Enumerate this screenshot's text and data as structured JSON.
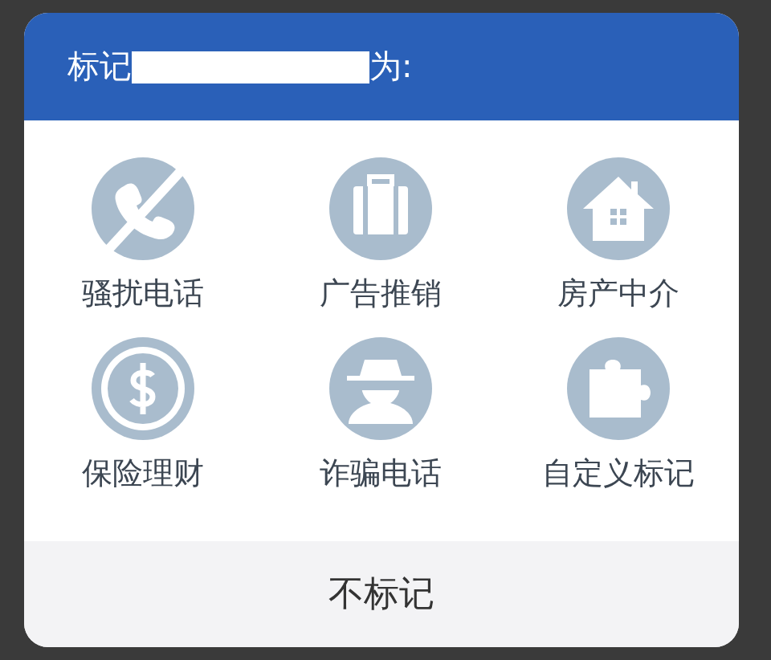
{
  "dialog": {
    "title_prefix": "标记",
    "title_suffix": "为:",
    "options": [
      {
        "kind": "blocked-phone",
        "label": "骚扰电话"
      },
      {
        "kind": "briefcase",
        "label": "广告推销"
      },
      {
        "kind": "house",
        "label": "房产中介"
      },
      {
        "kind": "coin",
        "label": "保险理财"
      },
      {
        "kind": "spy",
        "label": "诈骗电话"
      },
      {
        "kind": "puzzle",
        "label": "自定义标记"
      }
    ],
    "cancel_button": "不标记"
  }
}
